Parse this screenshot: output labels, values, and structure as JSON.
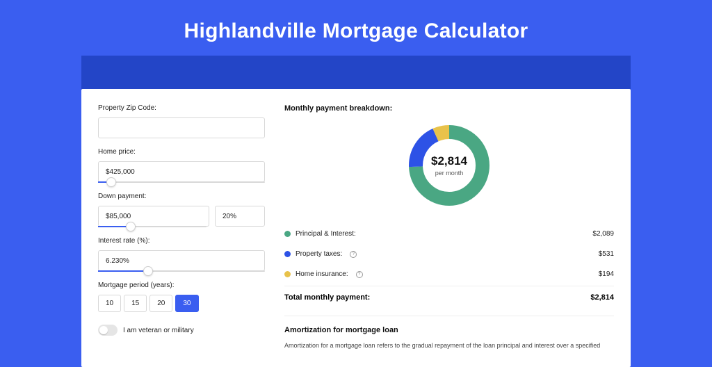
{
  "title": "Highlandville Mortgage Calculator",
  "form": {
    "zip": {
      "label": "Property Zip Code:",
      "value": ""
    },
    "homePrice": {
      "label": "Home price:",
      "value": "$425,000",
      "sliderPct": 8
    },
    "downPayment": {
      "label": "Down payment:",
      "amount": "$85,000",
      "percent": "20%",
      "sliderPct": 20
    },
    "interest": {
      "label": "Interest rate (%):",
      "value": "6.230%",
      "sliderPct": 30
    },
    "period": {
      "label": "Mortgage period (years):",
      "options": [
        "10",
        "15",
        "20",
        "30"
      ],
      "selected": "30"
    },
    "veteran": {
      "label": "I am veteran or military",
      "on": false
    }
  },
  "breakdown": {
    "title": "Monthly payment breakdown:",
    "center": {
      "value": "$2,814",
      "sub": "per month"
    },
    "items": [
      {
        "label": "Principal & Interest:",
        "value": "$2,089",
        "color": "#4aa783",
        "info": false
      },
      {
        "label": "Property taxes:",
        "value": "$531",
        "color": "#2d52e6",
        "info": true
      },
      {
        "label": "Home insurance:",
        "value": "$194",
        "color": "#e8c24a",
        "info": true
      }
    ],
    "total": {
      "label": "Total monthly payment:",
      "value": "$2,814"
    }
  },
  "amortization": {
    "title": "Amortization for mortgage loan",
    "text": "Amortization for a mortgage loan refers to the gradual repayment of the loan principal and interest over a specified"
  },
  "chart_data": {
    "type": "pie",
    "title": "Monthly payment breakdown",
    "categories": [
      "Principal & Interest",
      "Property taxes",
      "Home insurance"
    ],
    "values": [
      2089,
      531,
      194
    ],
    "colors": [
      "#4aa783",
      "#2d52e6",
      "#e8c24a"
    ],
    "total": 2814,
    "center_label": "$2,814 per month"
  }
}
